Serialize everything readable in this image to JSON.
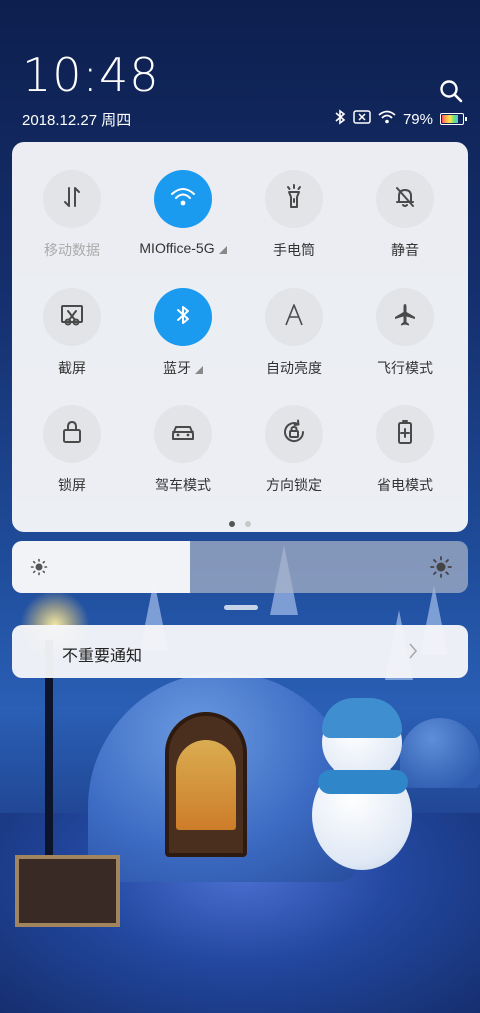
{
  "status": {
    "time": "10:48",
    "date": "2018.12.27 周四",
    "battery_percent_label": "79%",
    "battery_level": 0.79
  },
  "quick_settings": {
    "tiles": [
      {
        "label": "移动数据",
        "icon": "mobile-data-icon",
        "active": false,
        "dim": true
      },
      {
        "label": "MIOffice-5G",
        "icon": "wifi-icon",
        "active": true,
        "expandable": true
      },
      {
        "label": "手电筒",
        "icon": "flashlight-icon",
        "active": false
      },
      {
        "label": "静音",
        "icon": "bell-off-icon",
        "active": false
      },
      {
        "label": "截屏",
        "icon": "screenshot-icon",
        "active": false
      },
      {
        "label": "蓝牙",
        "icon": "bluetooth-icon",
        "active": true,
        "expandable": true
      },
      {
        "label": "自动亮度",
        "icon": "auto-brightness-icon",
        "active": false
      },
      {
        "label": "飞行模式",
        "icon": "airplane-icon",
        "active": false
      },
      {
        "label": "锁屏",
        "icon": "lock-icon",
        "active": false
      },
      {
        "label": "驾车模式",
        "icon": "car-icon",
        "active": false
      },
      {
        "label": "方向锁定",
        "icon": "rotation-lock-icon",
        "active": false
      },
      {
        "label": "省电模式",
        "icon": "battery-saver-icon",
        "active": false
      }
    ],
    "page_count": 2,
    "current_page": 1
  },
  "brightness": {
    "level": 0.39
  },
  "notification": {
    "label": "不重要通知"
  },
  "colors": {
    "accent": "#1b9bf0",
    "panel": "#f5f6f8"
  }
}
